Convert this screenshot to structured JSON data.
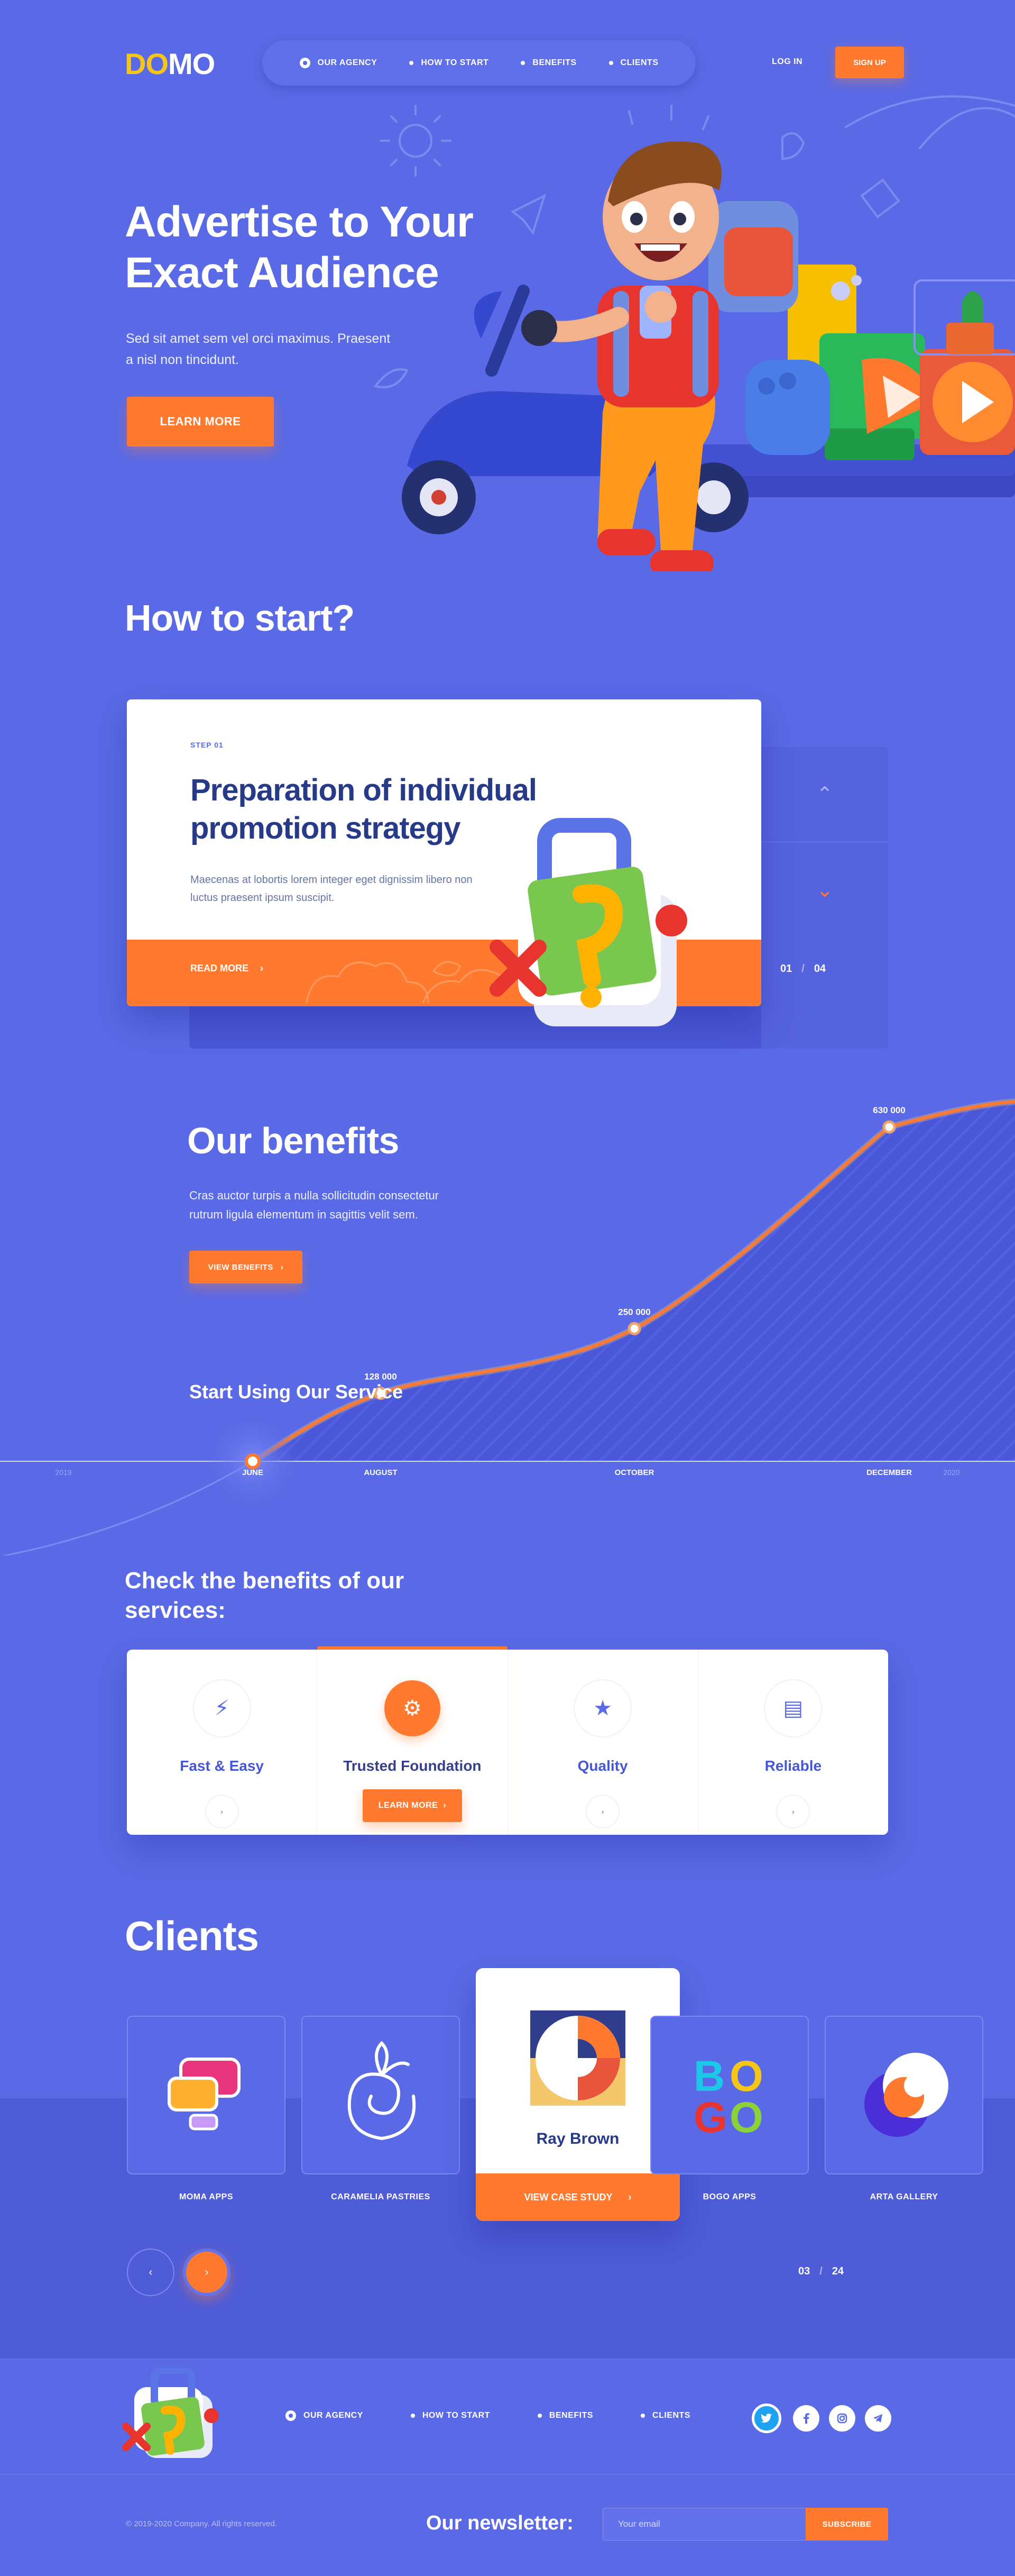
{
  "header": {
    "logo_do": "DO",
    "logo_mo": "MO",
    "nav": [
      "OUR AGENCY",
      "HOW TO START",
      "BENEFITS",
      "CLIENTS"
    ],
    "login": "LOG IN",
    "signup": "SIGN UP"
  },
  "hero": {
    "title": "Advertise to Your Exact Audience",
    "subtitle": "Sed sit amet sem vel orci maximus. Praesent a nisl non tincidunt.",
    "cta": "LEARN MORE"
  },
  "how_to_start": {
    "title": "How to start?",
    "step_label": "STEP 01",
    "step_title": "Preparation of individual promotion strategy",
    "step_text": "Maecenas at lobortis lorem integer eget dignissim libero non luctus praesent ipsum suscipit.",
    "read_more": "READ MORE",
    "read_more_arrow": "›",
    "current": "01",
    "total": "04",
    "sep": "/",
    "up_arrow": "⌃",
    "down_arrow": "⌄"
  },
  "benefits": {
    "title": "Our benefits",
    "text": "Cras auctor turpis a nulla sollicitudin consectetur rutrum ligula elementum in sagittis velit sem.",
    "cta": "VIEW BENEFITS",
    "cta_arrow": "›",
    "start_label": "Start Using Our Service",
    "chart_data": {
      "type": "line",
      "x": [
        "JUNE",
        "AUGUST",
        "OCTOBER",
        "DECEMBER"
      ],
      "series": [
        {
          "values": [
            0,
            128000,
            250000,
            630000
          ]
        }
      ],
      "point_labels": [
        "",
        "128 000",
        "250 000",
        "630 000"
      ],
      "x_edge_labels": [
        "2019",
        "2020"
      ],
      "ylim": [
        0,
        700000
      ],
      "grid": false,
      "line_color": "#ff7a2f"
    }
  },
  "services": {
    "title": "Check the benefits of our services:",
    "items": [
      {
        "name": "Fast & Easy",
        "icon": "bolt-icon",
        "glyph": "⚡",
        "arrow": "›"
      },
      {
        "name": "Trusted Foundation",
        "icon": "gear-icon",
        "glyph": "⚙",
        "cta": "LEARN MORE",
        "cta_arrow": "›"
      },
      {
        "name": "Quality",
        "icon": "star-icon",
        "glyph": "★",
        "arrow": "›"
      },
      {
        "name": "Reliable",
        "icon": "archive-icon",
        "glyph": "▤",
        "arrow": "›"
      }
    ]
  },
  "clients": {
    "title": "Clients",
    "items": [
      {
        "label": "MOMA APPS"
      },
      {
        "label": "CARAMELIA PASTRIES"
      },
      {
        "label": "BOGO APPS",
        "logo_letters": [
          "B",
          "O",
          "G",
          "O"
        ]
      },
      {
        "label": "ARTA GALLERY"
      }
    ],
    "featured": {
      "name": "Ray Brown",
      "cta": "VIEW CASE STUDY",
      "cta_arrow": "›"
    },
    "prev": "‹",
    "next": "›",
    "current": "03",
    "total": "24",
    "sep": "/"
  },
  "footer": {
    "nav": [
      "OUR AGENCY",
      "HOW TO START",
      "BENEFITS",
      "CLIENTS"
    ],
    "copyright": "© 2019-2020 Company. All rights reserved.",
    "newsletter_label": "Our newsletter:",
    "email_placeholder": "Your email",
    "subscribe": "SUBSCRIBE"
  },
  "colors": {
    "background": "#5a6ae6",
    "accent": "#ff7a2f",
    "logo_yellow": "#f5c518",
    "title_dark": "#263a88"
  }
}
